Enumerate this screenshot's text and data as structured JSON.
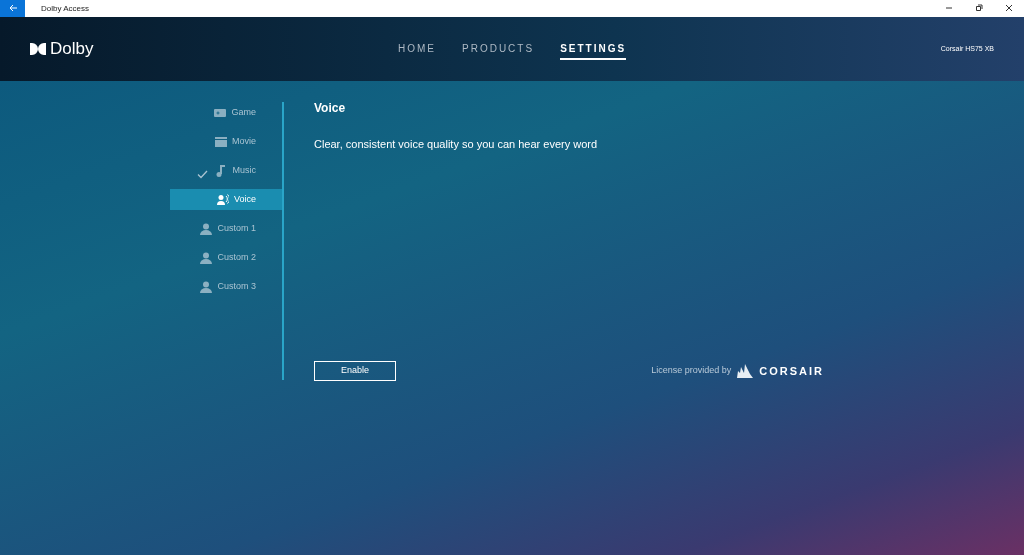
{
  "window": {
    "title": "Dolby Access"
  },
  "header": {
    "logo": "Dolby",
    "device": "Corsair HS75 XB"
  },
  "nav": [
    {
      "label": "HOME",
      "selected": false
    },
    {
      "label": "PRODUCTS",
      "selected": false
    },
    {
      "label": "SETTINGS",
      "selected": true
    }
  ],
  "sidebar": {
    "items": [
      {
        "label": "Game",
        "kind": "game",
        "selected": false,
        "checked": false
      },
      {
        "label": "Movie",
        "kind": "movie",
        "selected": false,
        "checked": false
      },
      {
        "label": "Music",
        "kind": "music",
        "selected": false,
        "checked": true
      },
      {
        "label": "Voice",
        "kind": "voice",
        "selected": true,
        "checked": false
      },
      {
        "label": "Custom 1",
        "kind": "custom",
        "selected": false,
        "checked": false
      },
      {
        "label": "Custom 2",
        "kind": "custom",
        "selected": false,
        "checked": false
      },
      {
        "label": "Custom 3",
        "kind": "custom",
        "selected": false,
        "checked": false
      }
    ]
  },
  "panel": {
    "title": "Voice",
    "description": "Clear, consistent voice quality so you can hear every word",
    "button": "Enable",
    "license": "License provided by",
    "brand": "CORSAIR"
  }
}
